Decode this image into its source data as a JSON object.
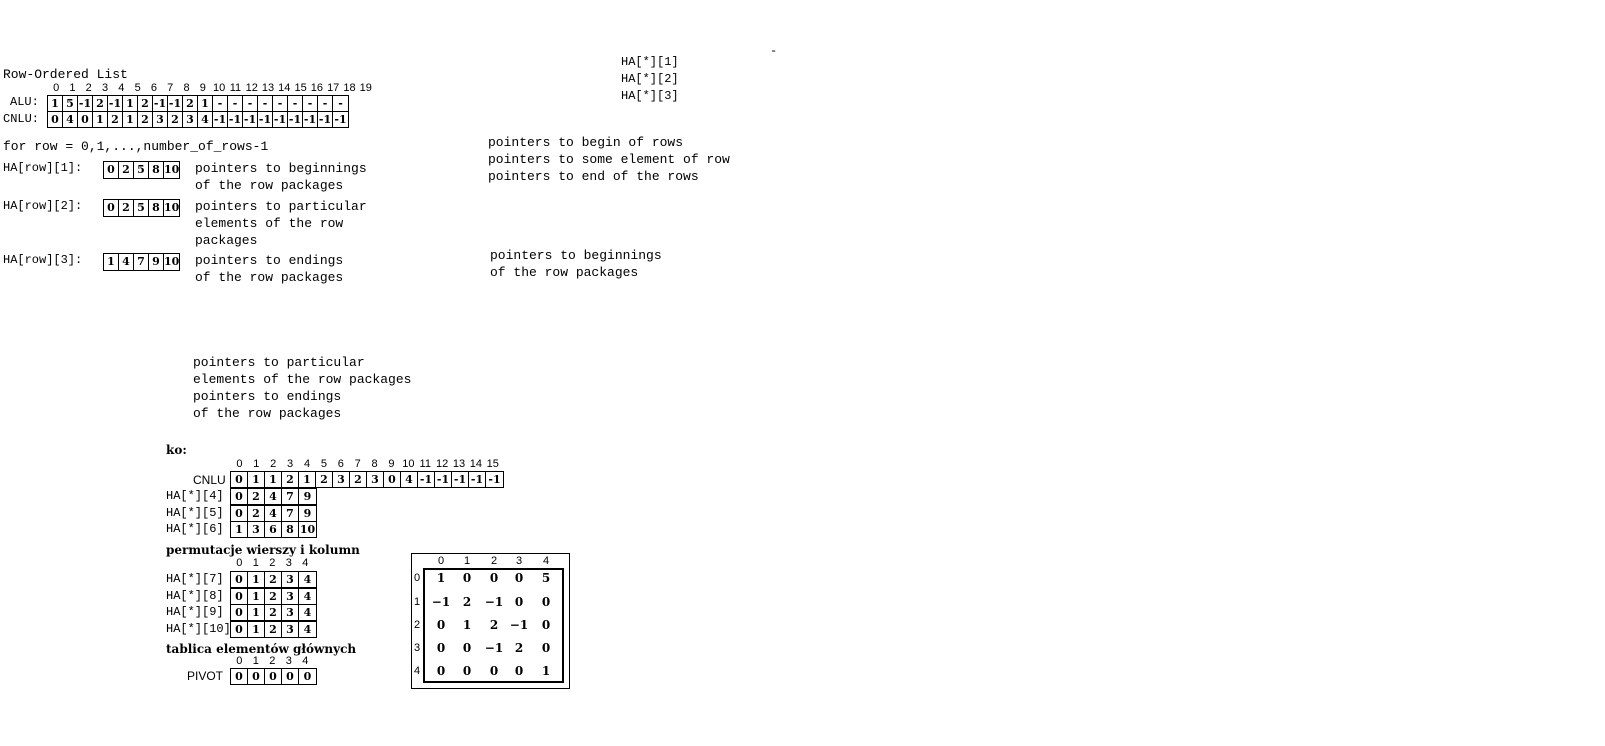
{
  "title": "Row-Ordered List",
  "top_index": [
    "0",
    "1",
    "2",
    "3",
    "4",
    "5",
    "6",
    "7",
    "8",
    "9",
    "10",
    "11",
    "12",
    "13",
    "14",
    "15",
    "16",
    "17",
    "18",
    "19"
  ],
  "alu_label": "ALU:",
  "alu": [
    "1",
    "5",
    "-1",
    "2",
    "-1",
    "1",
    "2",
    "-1",
    "-1",
    "2",
    "1",
    "-",
    "-",
    "-",
    "-",
    "-",
    "-",
    "-",
    "-",
    "-"
  ],
  "cnlu_label": "CNLU:",
  "cnlu": [
    "0",
    "4",
    "0",
    "1",
    "2",
    "1",
    "2",
    "3",
    "2",
    "3",
    "4",
    "-1",
    "-1",
    "-1",
    "-1",
    "-1",
    "-1",
    "-1",
    "-1",
    "-1"
  ],
  "for_row": "for row = 0,1,...,number_of_rows-1",
  "ha1_label": "HA[row][1]:",
  "ha1": [
    "0",
    "2",
    "5",
    "8",
    "10"
  ],
  "ha1_desc": "pointers to beginnings\nof the row packages",
  "ha2_label": "HA[row][2]:",
  "ha2": [
    "0",
    "2",
    "5",
    "8",
    "10"
  ],
  "ha2_desc": "pointers to particular\nelements of the row\npackages",
  "ha3_label": "HA[row][3]:",
  "ha3": [
    "1",
    "4",
    "7",
    "9",
    "10"
  ],
  "ha3_desc": "pointers to endings\nof the row packages",
  "right_ha": "HA[*][1]\nHA[*][2]\nHA[*][3]",
  "right_pointers": "pointers to begin of rows\npointers to some element of row\npointers to end of the rows",
  "right_begin": "pointers to beginnings\nof the row packages",
  "middle_text": "pointers to particular\nelements of the row packages\npointers to endings\nof the row packages",
  "ko_label": "ko:",
  "second_index": [
    "0",
    "1",
    "2",
    "3",
    "4",
    "5",
    "6",
    "7",
    "8",
    "9",
    "10",
    "11",
    "12",
    "13",
    "14",
    "15"
  ],
  "cnlu2_label": "CNLU",
  "cnlu2": [
    "0",
    "1",
    "1",
    "2",
    "1",
    "2",
    "3",
    "2",
    "3",
    "0",
    "4",
    "-1",
    "-1",
    "-1",
    "-1",
    "-1"
  ],
  "ha4_label": "HA[*][4]",
  "ha4": [
    "0",
    "2",
    "4",
    "7",
    "9"
  ],
  "ha5_label": "HA[*][5]",
  "ha5": [
    "0",
    "2",
    "4",
    "7",
    "9"
  ],
  "ha6_label": "HA[*][6]",
  "ha6": [
    "1",
    "3",
    "6",
    "8",
    "10"
  ],
  "perm_title": "permutacje wierszy i kolumn",
  "five_index": [
    "0",
    "1",
    "2",
    "3",
    "4"
  ],
  "ha7_label": "HA[*][7]",
  "ha7": [
    "0",
    "1",
    "2",
    "3",
    "4"
  ],
  "ha8_label": "HA[*][8]",
  "ha8": [
    "0",
    "1",
    "2",
    "3",
    "4"
  ],
  "ha9_label": "HA[*][9]",
  "ha9": [
    "0",
    "1",
    "2",
    "3",
    "4"
  ],
  "ha10_label": "HA[*][10]",
  "ha10": [
    "0",
    "1",
    "2",
    "3",
    "4"
  ],
  "pivot_title": "tablica elementów głównych",
  "pivot_label": "PIVOT",
  "pivot": [
    "0",
    "0",
    "0",
    "0",
    "0"
  ],
  "matrix": {
    "col_headers": [
      "0",
      "1",
      "2",
      "3",
      "4"
    ],
    "row_headers": [
      "0",
      "1",
      "2",
      "3",
      "4"
    ],
    "rows": [
      [
        "1",
        "0",
        "0",
        "0",
        "5"
      ],
      [
        "−1",
        "2",
        "−1",
        "0",
        "0"
      ],
      [
        "0",
        "1",
        "2",
        "−1",
        "0"
      ],
      [
        "0",
        "0",
        "−1",
        "2",
        "0"
      ],
      [
        "0",
        "0",
        "0",
        "0",
        "1"
      ]
    ]
  },
  "dash": "-"
}
